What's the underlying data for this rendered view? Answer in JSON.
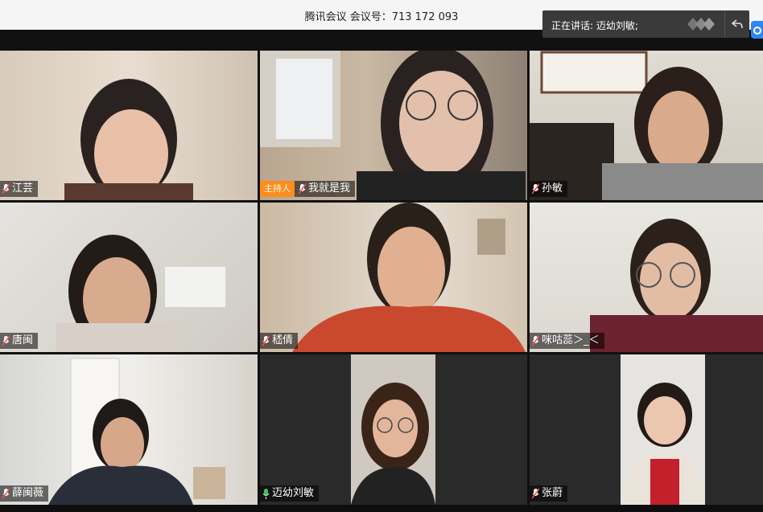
{
  "window": {
    "title": "腾讯会议 会议号：713 172 093"
  },
  "speaking": {
    "text": "正在讲话: 迈幼刘敏;"
  },
  "participants": [
    {
      "name": "江芸",
      "host": false,
      "mic": "muted"
    },
    {
      "name": "我就是我",
      "host": true,
      "host_label": "主持人",
      "mic": "muted"
    },
    {
      "name": "孙敏",
      "host": false,
      "mic": "muted"
    },
    {
      "name": "唐闽",
      "host": false,
      "mic": "muted"
    },
    {
      "name": "嵇倩",
      "host": false,
      "mic": "muted"
    },
    {
      "name": "咪咕蕊＞_＜",
      "host": false,
      "mic": "muted"
    },
    {
      "name": "薛闽薇",
      "host": false,
      "mic": "muted"
    },
    {
      "name": "迈幼刘敏",
      "host": false,
      "mic": "speaking"
    },
    {
      "name": "张蔚",
      "host": false,
      "mic": "muted"
    }
  ],
  "colors": {
    "host_badge": "#ff8c1a",
    "mic_muted": "#ff4d4f",
    "mic_speaking": "#35c759",
    "accent": "#2f86f6"
  }
}
